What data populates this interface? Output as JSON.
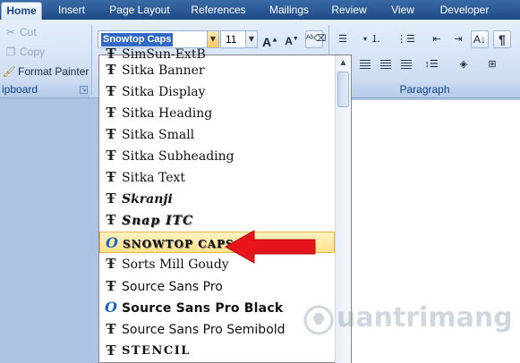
{
  "tabs": [
    {
      "label": "Home",
      "active": true
    },
    {
      "label": "Insert"
    },
    {
      "label": "Page Layout"
    },
    {
      "label": "References"
    },
    {
      "label": "Mailings"
    },
    {
      "label": "Review"
    },
    {
      "label": "View"
    },
    {
      "label": "Developer"
    }
  ],
  "clipboard": {
    "cut": "Cut",
    "copy": "Copy",
    "format_painter": "Format Painter",
    "group_label": "ipboard"
  },
  "font": {
    "name": "Snowtop Caps",
    "size": "11"
  },
  "paragraph": {
    "group_label": "Paragraph"
  },
  "font_list": [
    {
      "name": "SimSun-ExtB",
      "icon": "truetype-icon"
    },
    {
      "name": "Sitka Banner",
      "icon": "truetype-icon"
    },
    {
      "name": "Sitka Display",
      "icon": "truetype-icon"
    },
    {
      "name": "Sitka Heading",
      "icon": "truetype-icon"
    },
    {
      "name": "Sitka Small",
      "icon": "truetype-icon"
    },
    {
      "name": "Sitka Subheading",
      "icon": "truetype-icon"
    },
    {
      "name": "Sitka Text",
      "icon": "truetype-icon"
    },
    {
      "name": "Skranji",
      "icon": "truetype-icon"
    },
    {
      "name": "Snap ITC",
      "icon": "truetype-icon"
    },
    {
      "name": "SNOWTOP CAPS",
      "icon": "opentype-icon",
      "selected": true
    },
    {
      "name": "Sorts Mill Goudy",
      "icon": "truetype-icon"
    },
    {
      "name": "Source Sans Pro",
      "icon": "truetype-icon"
    },
    {
      "name": "Source Sans Pro Black",
      "icon": "opentype-icon"
    },
    {
      "name": "Source Sans Pro Semibold",
      "icon": "truetype-icon"
    },
    {
      "name": "STENCIL",
      "icon": "truetype-icon"
    }
  ],
  "colors": {
    "accent_arrow": "#e8141c",
    "selection": "#ffe28a",
    "ribbon_text": "#15428b"
  }
}
